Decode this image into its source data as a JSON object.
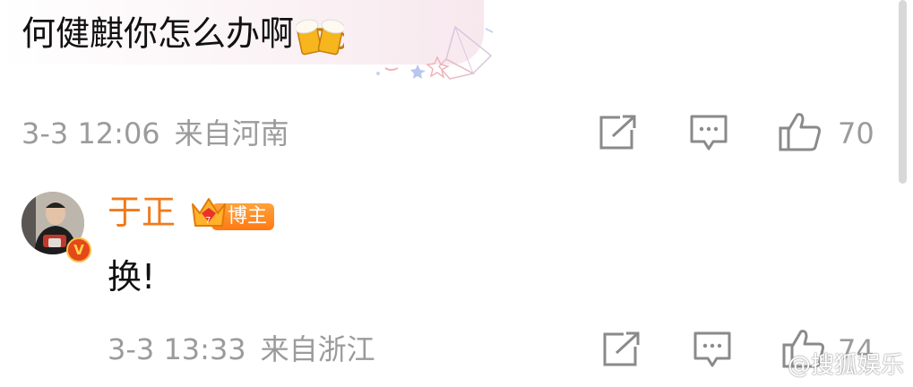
{
  "comment1": {
    "text": "何健麒你怎么办啊",
    "emoji_icon": "beer-mug-icon",
    "timestamp": "3-3 12:06",
    "location": "来自河南",
    "like_count": "70"
  },
  "reply": {
    "username": "于正",
    "badge_label": "博主",
    "text": "换!",
    "timestamp": "3-3 13:33",
    "location": "来自浙江",
    "like_count": "74"
  },
  "watermark": {
    "text": "@搜狐娱乐"
  },
  "colors": {
    "username": "#f07a1c",
    "meta_gray": "#9b9b9b",
    "badge_orange": "#ff8a1f"
  }
}
